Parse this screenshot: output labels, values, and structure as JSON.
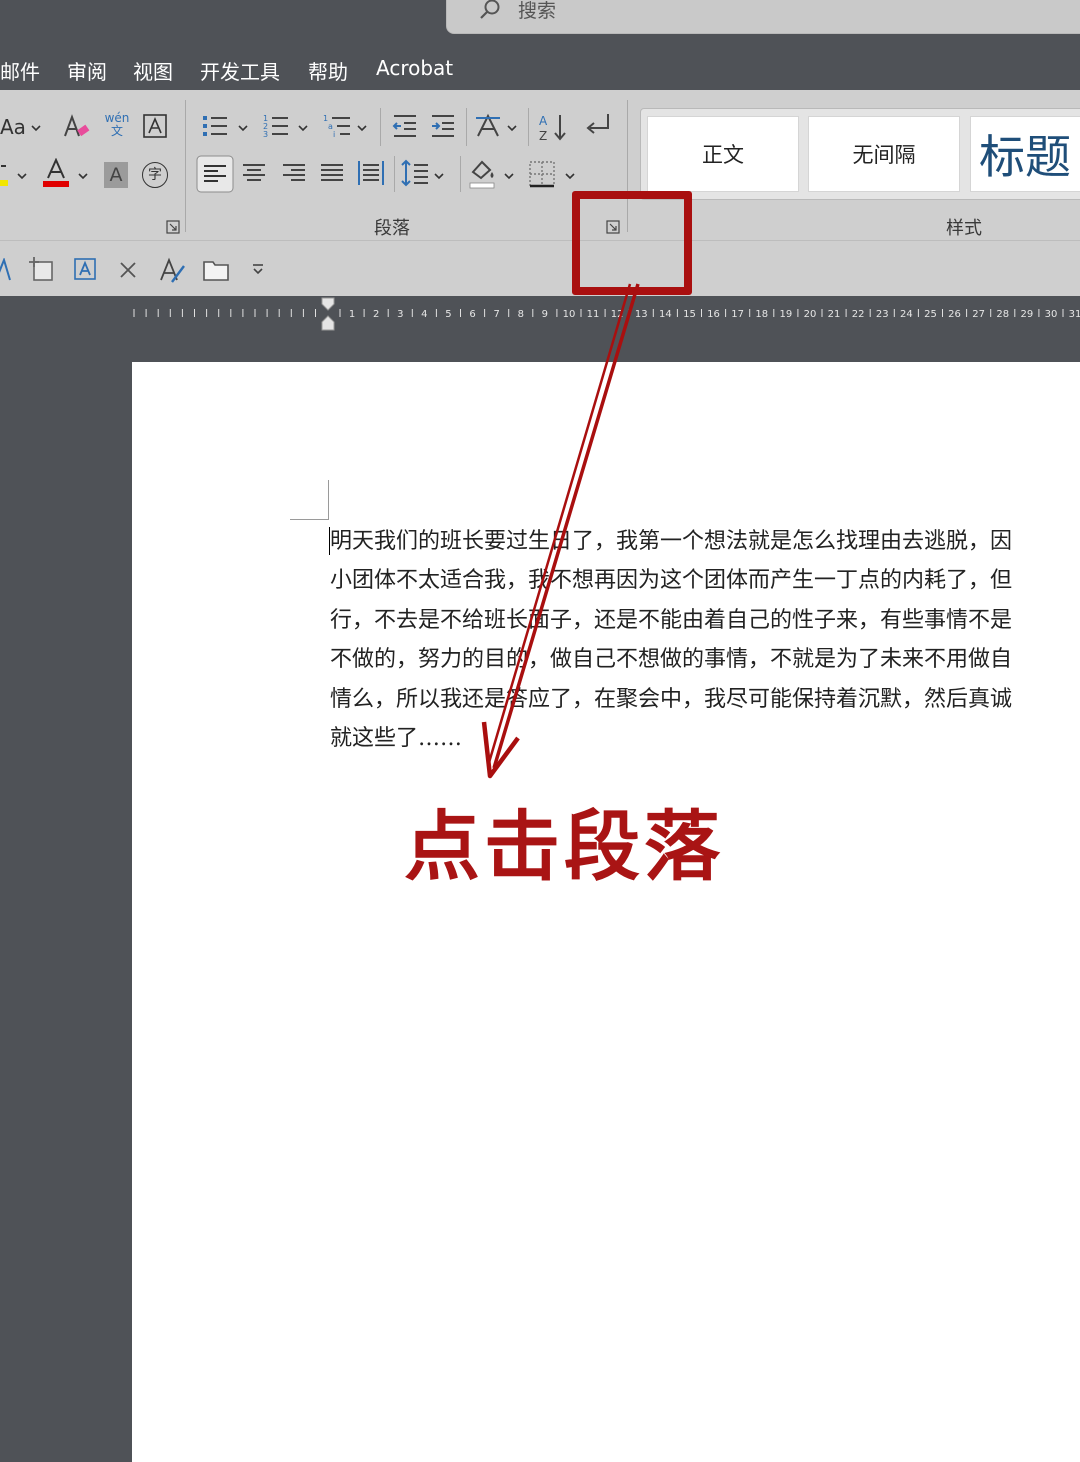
{
  "search": {
    "placeholder": "搜索"
  },
  "tabs": [
    "邮件",
    "审阅",
    "视图",
    "开发工具",
    "帮助",
    "Acrobat"
  ],
  "ribbon": {
    "groups": {
      "paragraph": "段落",
      "styles": "样式"
    },
    "phonetic_guide": {
      "top": "wén",
      "bottom": "文"
    },
    "char_shading": "A",
    "enclose_char": "字",
    "font_size_case": "Aa",
    "styles": [
      {
        "label": "正文"
      },
      {
        "label": "无间隔"
      },
      {
        "label": "标题"
      }
    ],
    "colors": {
      "font_color": "#e00000",
      "highlight": "#f2e600"
    }
  },
  "ruler": {
    "ticks": [
      "1",
      "2",
      "3",
      "4",
      "5",
      "6",
      "7",
      "8",
      "9",
      "10",
      "11",
      "12",
      "13",
      "14",
      "15",
      "16",
      "17",
      "18",
      "19",
      "20",
      "21",
      "22",
      "23",
      "24",
      "25",
      "26",
      "27",
      "28",
      "29",
      "30",
      "31"
    ]
  },
  "document": {
    "lines": [
      "明天我们的班长要过生日了，我第一个想法就是怎么找理由去逃脱，因",
      "小团体不太适合我，我不想再因为这个团体而产生一丁点的内耗了，但",
      "行，不去是不给班长面子，还是不能由着自己的性子来，有些事情不是",
      "不做的，努力的目的，做自己不想做的事情，不就是为了未来不用做自",
      "情么，所以我还是答应了，在聚会中，我尽可能保持着沉默，然后真诚",
      "就这些了……"
    ]
  },
  "annotation": {
    "label": "点击段落",
    "color": "#a90f0f"
  }
}
